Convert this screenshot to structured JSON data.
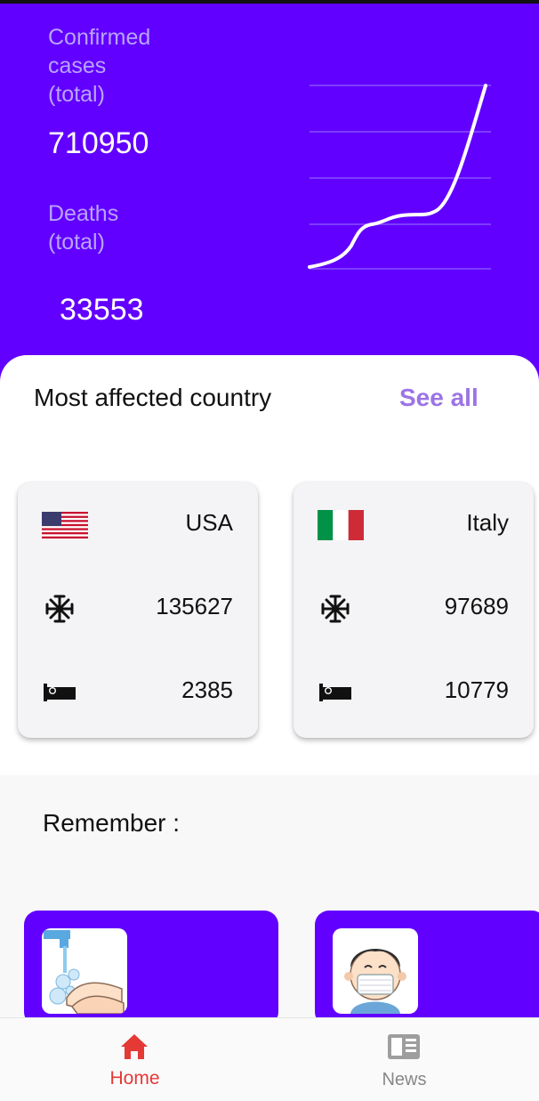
{
  "stats": {
    "confirmed_label": "Confirmed\ncases\n (total)",
    "confirmed_value": "710950",
    "deaths_label": "Deaths\n (total)",
    "deaths_value": "33553"
  },
  "affected": {
    "title": "Most affected country",
    "see_all": "See all",
    "countries": [
      {
        "name": "USA",
        "cases": "135627",
        "deaths": "2385",
        "flag": "us-flag-icon"
      },
      {
        "name": "Italy",
        "cases": "97689",
        "deaths": "10779",
        "flag": "italy-flag-icon"
      }
    ],
    "icons": {
      "cases": "virus-icon",
      "deaths": "bed-icon"
    }
  },
  "remember": {
    "title": "Remember :",
    "tips": [
      {
        "icon": "hand-washing-icon"
      },
      {
        "icon": "face-mask-icon"
      }
    ]
  },
  "nav": {
    "items": [
      {
        "label": "Home",
        "icon": "home-icon",
        "active": true
      },
      {
        "label": "News",
        "icon": "news-icon",
        "active": false
      }
    ]
  },
  "colors": {
    "primary": "#6200ff",
    "accent_link": "#9b74e6",
    "nav_active": "#e53935",
    "nav_inactive": "#888888"
  }
}
